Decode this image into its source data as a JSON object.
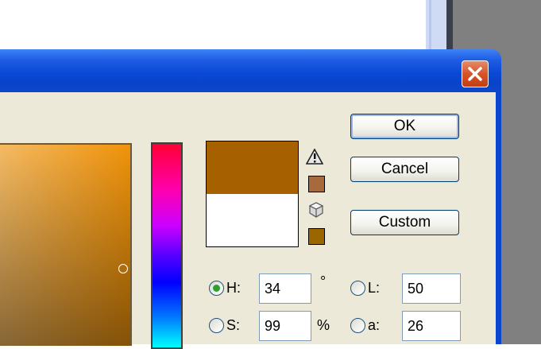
{
  "dialog": {
    "buttons": {
      "ok": "OK",
      "cancel": "Cancel",
      "custom": "Custom"
    },
    "colors": {
      "new_color": "#a66000",
      "current_color": "#ffffff",
      "gamut_swatch": "#a76a3c",
      "web_swatch": "#996600",
      "titlebar": "#0a49d6"
    },
    "fields": {
      "h": {
        "label": "H:",
        "value": "34",
        "unit": "°",
        "selected": true
      },
      "s": {
        "label": "S:",
        "value": "99",
        "unit": "%",
        "selected": false
      },
      "l": {
        "label": "L:",
        "value": "50",
        "selected": false
      },
      "a": {
        "label": "a:",
        "value": "26",
        "selected": false
      }
    },
    "icons": [
      "close-icon",
      "warning-icon",
      "cube-icon"
    ]
  }
}
